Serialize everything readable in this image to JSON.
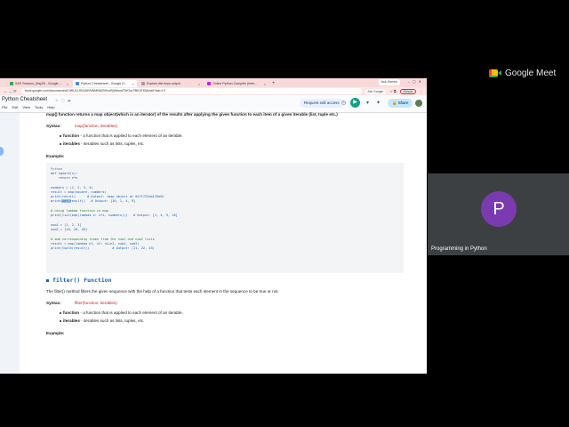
{
  "meet": {
    "logo_text": "Google Meet",
    "participant": {
      "initial": "P",
      "name": "Programming in Python"
    }
  },
  "browser": {
    "tabs": [
      {
        "label": "SAS Session_May26 - Google ...",
        "color": "#34a853",
        "active": false
      },
      {
        "label": "Python Cheatsheet - Google D...",
        "color": "#4285f4",
        "active": true
      },
      {
        "label": "Explain dict keys output",
        "color": "#9aa0a6",
        "active": false
      },
      {
        "label": "Online Python Compiler (Inter...",
        "color": "#c026d3",
        "active": false
      }
    ],
    "new_tab": "+",
    "ask_gemini": "Ask Gemini",
    "address": "docs.google.com/document/d/1IWLDLSNJAHSWMNMGHvuRjWbontTWOa-PBK9TKM/edit?tab=t.0",
    "ask_google": "Ask Google",
    "profile": "School"
  },
  "doc": {
    "title": "Python Cheatsheet",
    "menu": [
      "File",
      "Edit",
      "View",
      "Tools",
      "Help"
    ],
    "request_edit": "Request edit access",
    "share": "Share",
    "intro_line": "map() function returns a map object(which is an iterator) of the results after applying the given function to each item of a given iterable (list, tuple etc.)",
    "map_section": {
      "syntax_label": "Syntax:",
      "syntax_value": "map(function, iterables)",
      "bullets": [
        {
          "term": "function",
          "text": " - a function that is applied to each element of an iterable."
        },
        {
          "term": "iterables",
          "text": " - iterables such as lists, tuples, etc."
        }
      ],
      "example_label": "Example:"
    },
    "code_lines": [
      {
        "text": "Python",
        "kind": "gray"
      },
      {
        "text": "def square(n):",
        "kind": "code"
      },
      {
        "text": "    return n*n",
        "kind": "code"
      },
      {
        "text": "",
        "kind": "code"
      },
      {
        "text": "numbers = (1, 2, 3, 4)",
        "kind": "code"
      },
      {
        "text": "result = map(square, numbers)",
        "kind": "code"
      },
      {
        "text": "print(result)      # Output: <map object at 0x7f722da129e0>",
        "kind": "code"
      },
      {
        "text": "print(set(result))   # Output: {16, 1, 4, 9}",
        "kind": "code"
      },
      {
        "text": "",
        "kind": "code"
      },
      {
        "text": "# using lambda function in map",
        "kind": "comment"
      },
      {
        "text": "print(list(map(lambda x: x*x, numbers)))   # Output: [1, 4, 9, 16]",
        "kind": "code"
      },
      {
        "text": "",
        "kind": "code"
      },
      {
        "text": "num1 = [1, 2, 3]",
        "kind": "code"
      },
      {
        "text": "num2 = [10, 20, 40]",
        "kind": "code"
      },
      {
        "text": "",
        "kind": "code"
      },
      {
        "text": "# add corresponding items from the num1 and num2 lists",
        "kind": "comment"
      },
      {
        "text": "result = map(lambda n1, n2: n1+n2, num1, num2)",
        "kind": "code"
      },
      {
        "text": "print(tuple(result))            # Output: (11, 22, 43)",
        "kind": "code"
      }
    ],
    "filter_section": {
      "heading": "filter() Function",
      "description": "The filter() method filters the given sequence with the help of a function that tests each element in the sequence to be true or not.",
      "syntax_label": "Syntax:",
      "syntax_value": "filter(function, iterables)",
      "bullets": [
        {
          "term": "function",
          "text": " - a function that is applied to each element of an iterable."
        },
        {
          "term": "iterables",
          "text": " - iterables such as lists, tuples, etc."
        }
      ],
      "example_label": "Example:"
    }
  }
}
